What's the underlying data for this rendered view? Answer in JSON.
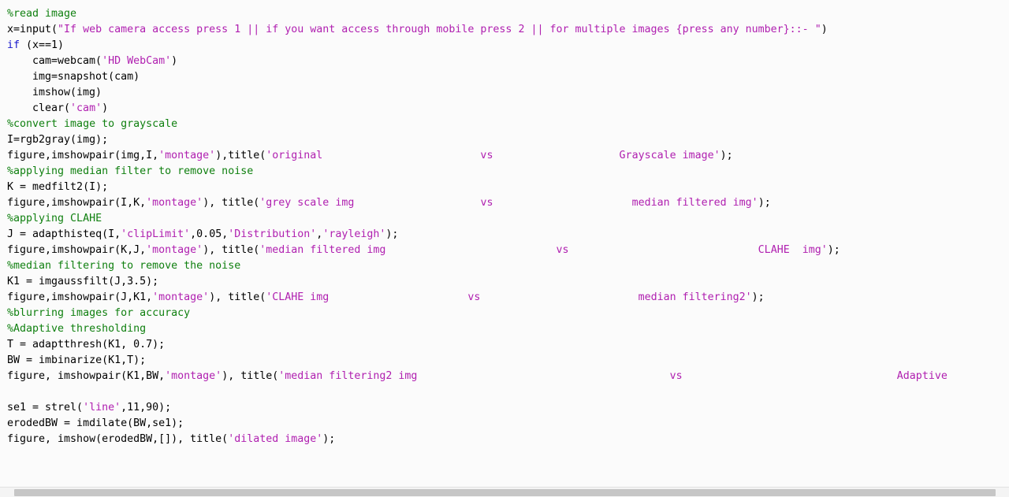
{
  "editor": {
    "language": "matlab",
    "colors": {
      "background": "#fbfbfb",
      "comment": "#108010",
      "keyword": "#1818cc",
      "string": "#b020b0",
      "plain": "#000000",
      "gutter": "#f2f2f2",
      "scrollbar_track": "#f4f4f4",
      "scrollbar_thumb": "#c6c6c6"
    },
    "lines": [
      {
        "n": 1,
        "indent": 0,
        "text": "%read image",
        "tokens": [
          {
            "t": "%read image",
            "c": "comment"
          }
        ]
      },
      {
        "n": 2,
        "indent": 0,
        "text": "x=input(\"If web camera access press 1 || if you want access through mobile press 2 || for multiple images {press any number}::- \")",
        "tokens": [
          {
            "t": "x=input(",
            "c": "plain"
          },
          {
            "t": "\"If web camera access press 1 || if you want access through mobile press 2 || for multiple images {press any number}::- \"",
            "c": "string"
          },
          {
            "t": ")",
            "c": "plain"
          }
        ]
      },
      {
        "n": 3,
        "indent": 0,
        "text": "if (x==1)",
        "tokens": [
          {
            "t": "if",
            "c": "keyword"
          },
          {
            "t": " (x==1)",
            "c": "plain"
          }
        ]
      },
      {
        "n": 4,
        "indent": 1,
        "text": "cam=webcam('HD WebCam')",
        "tokens": [
          {
            "t": "cam=webcam(",
            "c": "plain"
          },
          {
            "t": "'HD WebCam'",
            "c": "string"
          },
          {
            "t": ")",
            "c": "plain"
          }
        ]
      },
      {
        "n": 5,
        "indent": 1,
        "text": "img=snapshot(cam)",
        "tokens": [
          {
            "t": "img=snapshot(cam)",
            "c": "plain"
          }
        ]
      },
      {
        "n": 6,
        "indent": 1,
        "text": "imshow(img)",
        "tokens": [
          {
            "t": "imshow(img)",
            "c": "plain"
          }
        ]
      },
      {
        "n": 7,
        "indent": 1,
        "text": "clear('cam')",
        "tokens": [
          {
            "t": "clear(",
            "c": "plain"
          },
          {
            "t": "'cam'",
            "c": "string"
          },
          {
            "t": ")",
            "c": "plain"
          }
        ]
      },
      {
        "n": 8,
        "indent": 0,
        "text": "%convert image to grayscale",
        "tokens": [
          {
            "t": "%convert image to grayscale",
            "c": "comment"
          }
        ]
      },
      {
        "n": 9,
        "indent": 0,
        "text": "I=rgb2gray(img);",
        "tokens": [
          {
            "t": "I=rgb2gray(img);",
            "c": "plain"
          }
        ]
      },
      {
        "n": 10,
        "indent": 0,
        "text": "figure,imshowpair(img,I,'montage'),title('original                         vs                    Grayscale image');",
        "tokens": [
          {
            "t": "figure,imshowpair(img,I,",
            "c": "plain"
          },
          {
            "t": "'montage'",
            "c": "string"
          },
          {
            "t": "),title(",
            "c": "plain"
          },
          {
            "t": "'original                         vs                    Grayscale image'",
            "c": "string"
          },
          {
            "t": ");",
            "c": "plain"
          }
        ]
      },
      {
        "n": 11,
        "indent": 0,
        "text": "%applying median filter to remove noise",
        "tokens": [
          {
            "t": "%applying median filter to remove noise",
            "c": "comment"
          }
        ]
      },
      {
        "n": 12,
        "indent": 0,
        "text": "K = medfilt2(I);",
        "tokens": [
          {
            "t": "K = medfilt2(I);",
            "c": "plain"
          }
        ]
      },
      {
        "n": 13,
        "indent": 0,
        "text": "figure,imshowpair(I,K,'montage'), title('grey scale img                    vs                      median filtered img');",
        "tokens": [
          {
            "t": "figure,imshowpair(I,K,",
            "c": "plain"
          },
          {
            "t": "'montage'",
            "c": "string"
          },
          {
            "t": "), title(",
            "c": "plain"
          },
          {
            "t": "'grey scale img                    vs                      median filtered img'",
            "c": "string"
          },
          {
            "t": ");",
            "c": "plain"
          }
        ]
      },
      {
        "n": 14,
        "indent": 0,
        "text": "%applying CLAHE",
        "tokens": [
          {
            "t": "%applying CLAHE",
            "c": "comment"
          }
        ]
      },
      {
        "n": 15,
        "indent": 0,
        "text": "J = adapthisteq(I,'clipLimit',0.05,'Distribution','rayleigh');",
        "tokens": [
          {
            "t": "J = adapthisteq(I,",
            "c": "plain"
          },
          {
            "t": "'clipLimit'",
            "c": "string"
          },
          {
            "t": ",0.05,",
            "c": "plain"
          },
          {
            "t": "'Distribution'",
            "c": "string"
          },
          {
            "t": ",",
            "c": "plain"
          },
          {
            "t": "'rayleigh'",
            "c": "string"
          },
          {
            "t": ");",
            "c": "plain"
          }
        ]
      },
      {
        "n": 16,
        "indent": 0,
        "text": "figure,imshowpair(K,J,'montage'), title('median filtered img                           vs                              CLAHE  img');",
        "tokens": [
          {
            "t": "figure,imshowpair(K,J,",
            "c": "plain"
          },
          {
            "t": "'montage'",
            "c": "string"
          },
          {
            "t": "), title(",
            "c": "plain"
          },
          {
            "t": "'median filtered img                           vs                              CLAHE  img'",
            "c": "string"
          },
          {
            "t": ");",
            "c": "plain"
          }
        ]
      },
      {
        "n": 17,
        "indent": 0,
        "text": "%median filtering to remove the noise",
        "tokens": [
          {
            "t": "%median filtering to remove the noise",
            "c": "comment"
          }
        ]
      },
      {
        "n": 18,
        "indent": 0,
        "text": "K1 = imgaussfilt(J,3.5);",
        "tokens": [
          {
            "t": "K1 = imgaussfilt(J,3.5);",
            "c": "plain"
          }
        ]
      },
      {
        "n": 19,
        "indent": 0,
        "text": "figure,imshowpair(J,K1,'montage'), title('CLAHE img                      vs                         median filtering2');",
        "tokens": [
          {
            "t": "figure,imshowpair(J,K1,",
            "c": "plain"
          },
          {
            "t": "'montage'",
            "c": "string"
          },
          {
            "t": "), title(",
            "c": "plain"
          },
          {
            "t": "'CLAHE img                      vs                         median filtering2'",
            "c": "string"
          },
          {
            "t": ");",
            "c": "plain"
          }
        ]
      },
      {
        "n": 20,
        "indent": 0,
        "text": "%blurring images for accuracy",
        "tokens": [
          {
            "t": "%blurring images for accuracy",
            "c": "comment"
          }
        ]
      },
      {
        "n": 21,
        "indent": 0,
        "text": "%Adaptive thresholding",
        "tokens": [
          {
            "t": "%Adaptive thresholding",
            "c": "comment"
          }
        ]
      },
      {
        "n": 22,
        "indent": 0,
        "text": "T = adaptthresh(K1, 0.7);",
        "tokens": [
          {
            "t": "T = adaptthresh(K1, 0.7);",
            "c": "plain"
          }
        ]
      },
      {
        "n": 23,
        "indent": 0,
        "text": "BW = imbinarize(K1,T);",
        "tokens": [
          {
            "t": "BW = imbinarize(K1,T);",
            "c": "plain"
          }
        ]
      },
      {
        "n": 24,
        "indent": 0,
        "text": "figure, imshowpair(K1,BW,'montage'), title('median filtering2 img                                        vs                                  Adaptive",
        "tokens": [
          {
            "t": "figure, imshowpair(K1,BW,",
            "c": "plain"
          },
          {
            "t": "'montage'",
            "c": "string"
          },
          {
            "t": "), title(",
            "c": "plain"
          },
          {
            "t": "'median filtering2 img                                        vs                                  Adaptive",
            "c": "string"
          }
        ]
      },
      {
        "n": 25,
        "indent": 0,
        "text": "",
        "tokens": []
      },
      {
        "n": 26,
        "indent": 0,
        "text": "se1 = strel('line',11,90);",
        "tokens": [
          {
            "t": "se1 = strel(",
            "c": "plain"
          },
          {
            "t": "'line'",
            "c": "string"
          },
          {
            "t": ",11,90);",
            "c": "plain"
          }
        ]
      },
      {
        "n": 27,
        "indent": 0,
        "text": "erodedBW = imdilate(BW,se1);",
        "tokens": [
          {
            "t": "erodedBW = imdilate(BW,se1);",
            "c": "plain"
          }
        ]
      },
      {
        "n": 28,
        "indent": 0,
        "text": "figure, imshow(erodedBW,[]), title('dilated image');",
        "tokens": [
          {
            "t": "figure, imshow(erodedBW,[]), title(",
            "c": "plain"
          },
          {
            "t": "'dilated image'",
            "c": "string"
          },
          {
            "t": ");",
            "c": "plain"
          }
        ]
      }
    ]
  },
  "scrollbar": {
    "orientation": "horizontal",
    "position": "bottom"
  }
}
